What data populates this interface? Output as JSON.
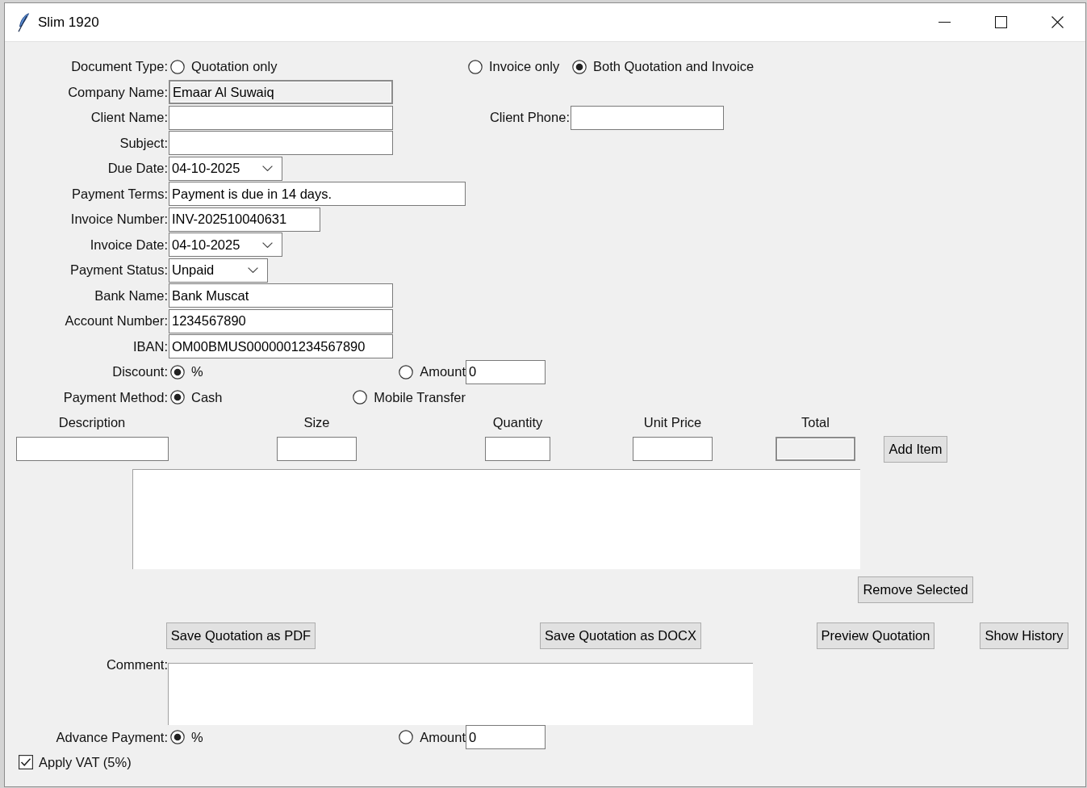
{
  "window": {
    "title": "Slim 1920"
  },
  "document_type": {
    "label": "Document Type:",
    "options": [
      {
        "label": "Quotation only",
        "selected": false
      },
      {
        "label": "Invoice only",
        "selected": false
      },
      {
        "label": "Both Quotation and Invoice",
        "selected": true
      }
    ]
  },
  "fields": [
    {
      "label": "Company Name:",
      "kind": "entry",
      "value": "Emaar Al Suwaiq",
      "readonly": true
    },
    {
      "label": "Client Name:",
      "kind": "entry",
      "readonly": false
    },
    {
      "label": "Subject:",
      "kind": "entry",
      "readonly": false
    },
    {
      "label": "Due Date:",
      "kind": "combo",
      "value": "04-10-2025",
      "readonly": false
    },
    {
      "label": "Payment Terms:",
      "kind": "entry",
      "value": "Payment is due in 14 days.",
      "readonly": false
    },
    {
      "label": "Invoice Number:",
      "kind": "entry",
      "value": "INV-202510040631",
      "readonly": false
    },
    {
      "label": "Invoice Date:",
      "kind": "combo",
      "value": "04-10-2025",
      "readonly": false
    },
    {
      "label": "Payment Status:",
      "kind": "combo",
      "value": "Unpaid",
      "readonly": false
    },
    {
      "label": "Bank Name:",
      "kind": "entry",
      "value": "Bank Muscat",
      "readonly": false
    },
    {
      "label": "Account Number:",
      "kind": "entry",
      "value": "1234567890",
      "readonly": false
    },
    {
      "label": "IBAN:",
      "kind": "entry",
      "value": "OM00BMUS0000001234567890",
      "readonly": false
    }
  ],
  "client_phone": {
    "label": "Client Phone:"
  },
  "discount": {
    "label": "Discount:",
    "options": [
      {
        "label": "%",
        "selected": true
      },
      {
        "label": "Amount",
        "selected": false
      }
    ],
    "amount": "0"
  },
  "payment_method": {
    "label": "Payment Method:",
    "options": [
      {
        "label": "Cash",
        "selected": true
      },
      {
        "label": "Mobile Transfer",
        "selected": false
      }
    ]
  },
  "item_entry": {
    "columns": [
      {
        "label": "Description",
        "readonly": false
      },
      {
        "label": "Size",
        "readonly": false
      },
      {
        "label": "Quantity",
        "readonly": false
      },
      {
        "label": "Unit Price",
        "readonly": false
      },
      {
        "label": "Total",
        "readonly": true
      }
    ],
    "add_button": "Add Item"
  },
  "items_list": {
    "remove_button": "Remove Selected"
  },
  "actions": [
    "Save Quotation as PDF",
    "Save Quotation as DOCX",
    "Preview Quotation",
    "Show History"
  ],
  "comment": {
    "label": "Comment:"
  },
  "advance_payment": {
    "label": "Advance Payment:",
    "options": [
      {
        "label": "%",
        "selected": true
      },
      {
        "label": "Amount",
        "selected": false
      }
    ],
    "amount": "0"
  },
  "apply_vat": {
    "label": "Apply VAT (5%)",
    "checked": true
  }
}
